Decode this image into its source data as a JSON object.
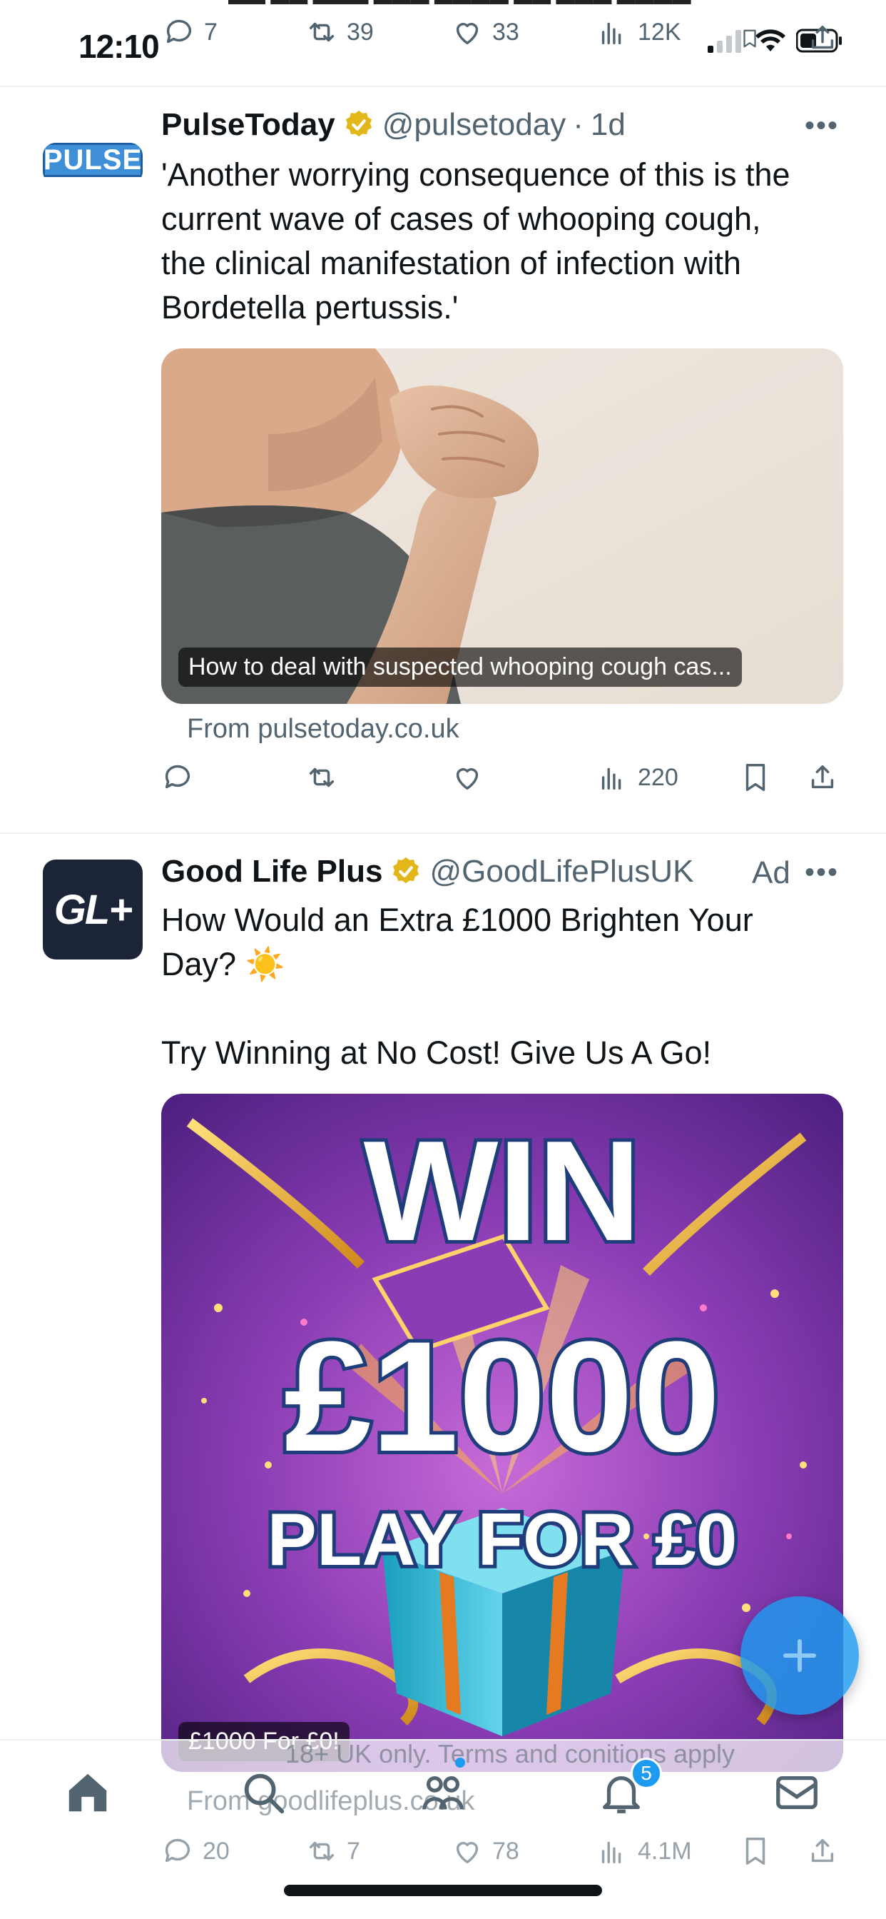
{
  "status_bar": {
    "time": "12:10",
    "prev_tweet_actions": {
      "replies": "7",
      "reposts": "39",
      "likes": "33",
      "views": "12K"
    }
  },
  "tweets": [
    {
      "author_name": "PulseToday",
      "handle": "@pulsetoday",
      "separator": "·",
      "time": "1d",
      "avatar_text": "PULSE",
      "text_lines": [
        "'Another worrying consequence of this is the",
        "current wave of cases of whooping cough,",
        "the clinical manifestation of infection with",
        "Bordetella pertussis.'"
      ],
      "card_caption": "How to deal with suspected whooping cough cas...",
      "card_source": "From pulsetoday.co.uk",
      "views": "220"
    },
    {
      "author_name": "Good Life Plus",
      "handle": "@GoodLifePlusUK",
      "ad_label": "Ad",
      "avatar_text": "GL+",
      "text_line_1": "How Would an Extra £1000 Brighten Your",
      "text_line_2": "Day? ☀️",
      "text_line_3": "Try Winning at No Cost! Give Us A Go!",
      "image_text": {
        "line1": "WIN",
        "line2": "£1000",
        "line3": "PLAY FOR £0"
      },
      "card_caption": "£1000 For £0!",
      "card_terms": "18+ UK only. Terms and conitions apply",
      "card_source": "From goodlifeplus.co.uk",
      "replies": "20",
      "reposts": "7",
      "likes": "78",
      "views": "4.1M"
    }
  ],
  "tab_bar": {
    "notifications_badge": "5"
  },
  "colors": {
    "accent": "#1d9bf0",
    "muted": "#536471",
    "verified_gold": "#e2b719"
  }
}
